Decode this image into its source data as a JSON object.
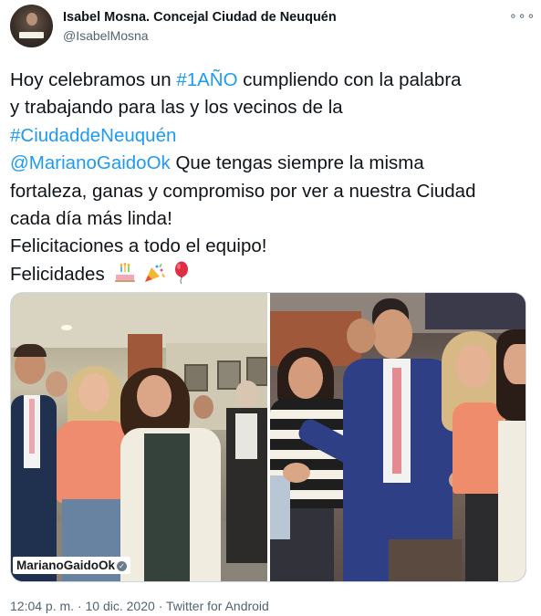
{
  "author": {
    "name": "Isabel Mosna. Concejal Ciudad de Neuquén",
    "handle": "@IsabelMosna",
    "avatar_icon": "profile-photo"
  },
  "more_icon": "more-options-icon",
  "tweet": {
    "line1_pre": "Hoy celebramos un ",
    "hashtag1": "#1AÑO",
    "line1_post": " cumpliendo con la palabra",
    "line2": "y trabajando para las y los vecinos de la",
    "hashtag2": "#CiudaddeNeuquén",
    "mention": "@MarianoGaidoOk",
    "line4_post": " Que tengas siempre la misma",
    "line5": "fortaleza, ganas y compromiso por ver a nuestra Ciudad",
    "line6": "cada día más linda!",
    "line7": "Felicitaciones a todo el equipo!",
    "line8": "Felicidades",
    "emojis": [
      "birthday-cake",
      "party-popper",
      "balloon"
    ]
  },
  "media": {
    "watermark_pre": "Mariano",
    "watermark_bold": "GaidoOk",
    "watermark_check": "✓"
  },
  "footer": {
    "time": "12:04 p. m.",
    "separator": "·",
    "date": "10 dic. 2020",
    "source": "Twitter for Android"
  },
  "colors": {
    "link": "#1d9bf0",
    "text": "#0f1419",
    "secondary": "#536471"
  }
}
